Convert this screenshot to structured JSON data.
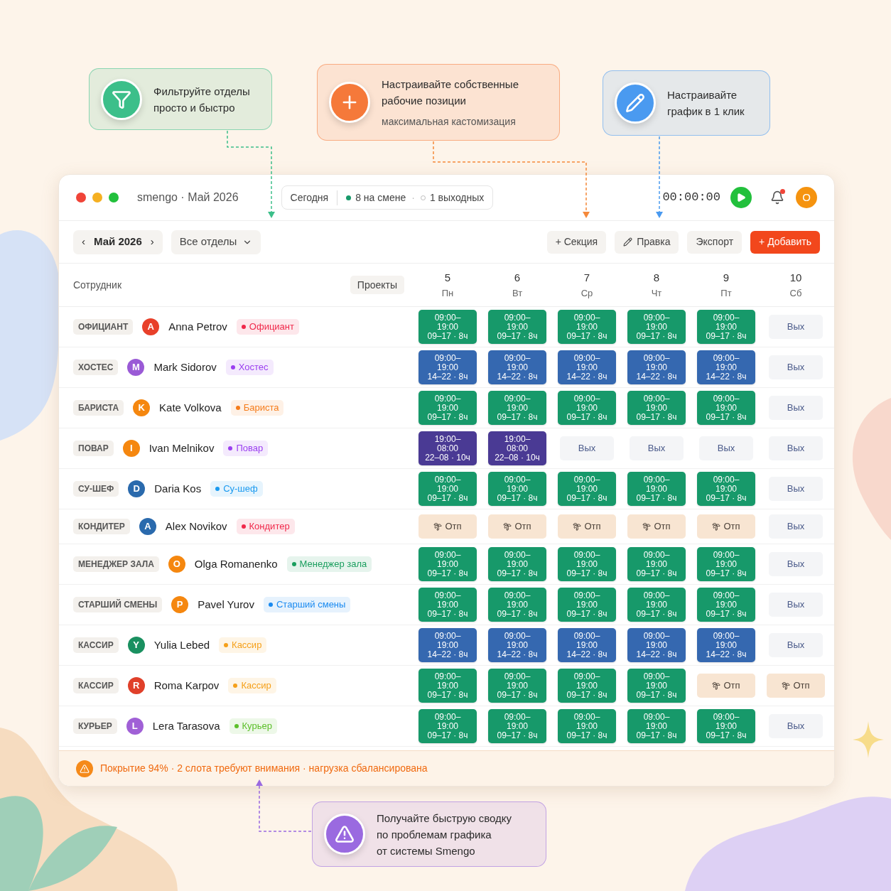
{
  "callouts": [
    {
      "kind": "filter",
      "color": "#3cbf8a",
      "lines": [
        "Фильтруйте отделы",
        "просто и быстро"
      ]
    },
    {
      "kind": "plus",
      "color": "#f5793a",
      "lines": [
        "Настраивайте собственные",
        "рабочие позиции"
      ],
      "subtitle": "максимальная кастомизация"
    },
    {
      "kind": "pencil",
      "color": "#4a9af0",
      "lines": [
        "Настраивайте",
        "график в 1 клик"
      ]
    },
    {
      "kind": "warning",
      "color": "#9a6ae0",
      "lines": [
        "Получайте быструю сводку",
        "по проблемам графика",
        "от системы Smengo"
      ]
    }
  ],
  "window": {
    "title": "smengo · Май 2026",
    "today": "Сегодня",
    "on_shift": "8 на смене",
    "separator": "·",
    "days_off": "1 выходных",
    "timer": "00:00:00",
    "notification": true,
    "avatar": "O"
  },
  "toolbar": {
    "prev": "‹",
    "month": "Май 2026",
    "next": "›",
    "department_filter": "Все отделы",
    "buttons": [
      {
        "kind": "section",
        "label": "+ Секция"
      },
      {
        "kind": "edit",
        "label": "Правка"
      },
      {
        "kind": "export",
        "label": "Экспорт"
      },
      {
        "kind": "add",
        "label": "+ Добавить"
      }
    ]
  },
  "table": {
    "employee_header": "Сотрудник",
    "projects_button": "Проекты",
    "days": [
      {
        "number": "5",
        "weekday": "Пн"
      },
      {
        "number": "6",
        "weekday": "Вт"
      },
      {
        "number": "7",
        "weekday": "Ср"
      },
      {
        "number": "8",
        "weekday": "Чт"
      },
      {
        "number": "9",
        "weekday": "Пт"
      },
      {
        "number": "10",
        "weekday": "Сб"
      }
    ],
    "rows": [
      {
        "department": "ОФИЦИАНТ",
        "avatar": {
          "initial": "A",
          "color": "#e8402a"
        },
        "name": "Anna Petrov",
        "role": {
          "label": "Официант",
          "color": "#f0284a"
        },
        "shifts": [
          {
            "kind": "shift",
            "color": "#17996a",
            "start": "09:00–",
            "end": "19:00",
            "range": "09–17 · 8ч"
          },
          {
            "kind": "shift",
            "color": "#17996a",
            "start": "09:00–",
            "end": "19:00",
            "range": "09–17 · 8ч"
          },
          {
            "kind": "shift",
            "color": "#17996a",
            "start": "09:00–",
            "end": "19:00",
            "range": "09–17 · 8ч"
          },
          {
            "kind": "shift",
            "color": "#17996a",
            "start": "09:00–",
            "end": "19:00",
            "range": "09–17 · 8ч"
          },
          {
            "kind": "shift",
            "color": "#17996a",
            "start": "09:00–",
            "end": "19:00",
            "range": "09–17 · 8ч"
          },
          {
            "kind": "off",
            "label": "Вых"
          }
        ]
      },
      {
        "department": "ХОСТЕС",
        "avatar": {
          "initial": "M",
          "color": "#9a5ad6"
        },
        "name": "Mark Sidorov",
        "role": {
          "label": "Хостес",
          "color": "#9b3ff0"
        },
        "shifts": [
          {
            "kind": "shift",
            "color": "#3568b0",
            "start": "09:00–",
            "end": "19:00",
            "range": "14–22 · 8ч"
          },
          {
            "kind": "shift",
            "color": "#3568b0",
            "start": "09:00–",
            "end": "19:00",
            "range": "14–22 · 8ч"
          },
          {
            "kind": "shift",
            "color": "#3568b0",
            "start": "09:00–",
            "end": "19:00",
            "range": "14–22 · 8ч"
          },
          {
            "kind": "shift",
            "color": "#3568b0",
            "start": "09:00–",
            "end": "19:00",
            "range": "14–22 · 8ч"
          },
          {
            "kind": "shift",
            "color": "#3568b0",
            "start": "09:00–",
            "end": "19:00",
            "range": "14–22 · 8ч"
          },
          {
            "kind": "off",
            "label": "Вых"
          }
        ]
      },
      {
        "department": "БАРИСТА",
        "avatar": {
          "initial": "K",
          "color": "#f5870f"
        },
        "name": "Kate Volkova",
        "role": {
          "label": "Бариста",
          "color": "#f57c1a"
        },
        "shifts": [
          {
            "kind": "shift",
            "color": "#17996a",
            "start": "09:00–",
            "end": "19:00",
            "range": "09–17 · 8ч"
          },
          {
            "kind": "shift",
            "color": "#17996a",
            "start": "09:00–",
            "end": "19:00",
            "range": "09–17 · 8ч"
          },
          {
            "kind": "shift",
            "color": "#17996a",
            "start": "09:00–",
            "end": "19:00",
            "range": "09–17 · 8ч"
          },
          {
            "kind": "shift",
            "color": "#17996a",
            "start": "09:00–",
            "end": "19:00",
            "range": "09–17 · 8ч"
          },
          {
            "kind": "shift",
            "color": "#17996a",
            "start": "09:00–",
            "end": "19:00",
            "range": "09–17 · 8ч"
          },
          {
            "kind": "off",
            "label": "Вых"
          }
        ]
      },
      {
        "department": "ПОВАР",
        "avatar": {
          "initial": "I",
          "color": "#f5870f"
        },
        "name": "Ivan Melnikov",
        "role": {
          "label": "Повар",
          "color": "#9b3ff0"
        },
        "shifts": [
          {
            "kind": "shift",
            "color": "#4a3a94",
            "start": "19:00–",
            "end": "08:00",
            "range": "22–08 · 10ч"
          },
          {
            "kind": "shift",
            "color": "#4a3a94",
            "start": "19:00–",
            "end": "08:00",
            "range": "22–08 · 10ч"
          },
          {
            "kind": "off",
            "label": "Вых"
          },
          {
            "kind": "off",
            "label": "Вых"
          },
          {
            "kind": "off",
            "label": "Вых"
          },
          {
            "kind": "off",
            "label": "Вых"
          }
        ]
      },
      {
        "department": "СУ-ШЕФ",
        "avatar": {
          "initial": "D",
          "color": "#2a6aad"
        },
        "name": "Daria Kos",
        "role": {
          "label": "Су-шеф",
          "color": "#1a9af0"
        },
        "shifts": [
          {
            "kind": "shift",
            "color": "#17996a",
            "start": "09:00–",
            "end": "19:00",
            "range": "09–17 · 8ч"
          },
          {
            "kind": "shift",
            "color": "#17996a",
            "start": "09:00–",
            "end": "19:00",
            "range": "09–17 · 8ч"
          },
          {
            "kind": "shift",
            "color": "#17996a",
            "start": "09:00–",
            "end": "19:00",
            "range": "09–17 · 8ч"
          },
          {
            "kind": "shift",
            "color": "#17996a",
            "start": "09:00–",
            "end": "19:00",
            "range": "09–17 · 8ч"
          },
          {
            "kind": "shift",
            "color": "#17996a",
            "start": "09:00–",
            "end": "19:00",
            "range": "09–17 · 8ч"
          },
          {
            "kind": "off",
            "label": "Вых"
          }
        ]
      },
      {
        "department": "КОНДИТЕР",
        "avatar": {
          "initial": "A",
          "color": "#2a6aad"
        },
        "name": "Alex Novikov",
        "role": {
          "label": "Кондитер",
          "color": "#f0284a"
        },
        "shifts": [
          {
            "kind": "vacation",
            "label": "Отп"
          },
          {
            "kind": "vacation",
            "label": "Отп"
          },
          {
            "kind": "vacation",
            "label": "Отп"
          },
          {
            "kind": "vacation",
            "label": "Отп"
          },
          {
            "kind": "vacation",
            "label": "Отп"
          },
          {
            "kind": "off",
            "label": "Вых"
          }
        ]
      },
      {
        "department": "МЕНЕДЖЕР ЗАЛА",
        "avatar": {
          "initial": "O",
          "color": "#f5870f"
        },
        "name": "Olga Romanenko",
        "role": {
          "label": "Менеджер зала",
          "color": "#1a9e5e"
        },
        "shifts": [
          {
            "kind": "shift",
            "color": "#17996a",
            "start": "09:00–",
            "end": "19:00",
            "range": "09–17 · 8ч"
          },
          {
            "kind": "shift",
            "color": "#17996a",
            "start": "09:00–",
            "end": "19:00",
            "range": "09–17 · 8ч"
          },
          {
            "kind": "shift",
            "color": "#17996a",
            "start": "09:00–",
            "end": "19:00",
            "range": "09–17 · 8ч"
          },
          {
            "kind": "shift",
            "color": "#17996a",
            "start": "09:00–",
            "end": "19:00",
            "range": "09–17 · 8ч"
          },
          {
            "kind": "shift",
            "color": "#17996a",
            "start": "09:00–",
            "end": "19:00",
            "range": "09–17 · 8ч"
          },
          {
            "kind": "off",
            "label": "Вых"
          }
        ]
      },
      {
        "department": "СТАРШИЙ СМЕНЫ",
        "avatar": {
          "initial": "P",
          "color": "#f5870f"
        },
        "name": "Pavel Yurov",
        "role": {
          "label": "Старший смены",
          "color": "#1a8af0"
        },
        "shifts": [
          {
            "kind": "shift",
            "color": "#17996a",
            "start": "09:00–",
            "end": "19:00",
            "range": "09–17 · 8ч"
          },
          {
            "kind": "shift",
            "color": "#17996a",
            "start": "09:00–",
            "end": "19:00",
            "range": "09–17 · 8ч"
          },
          {
            "kind": "shift",
            "color": "#17996a",
            "start": "09:00–",
            "end": "19:00",
            "range": "09–17 · 8ч"
          },
          {
            "kind": "shift",
            "color": "#17996a",
            "start": "09:00–",
            "end": "19:00",
            "range": "09–17 · 8ч"
          },
          {
            "kind": "shift",
            "color": "#17996a",
            "start": "09:00–",
            "end": "19:00",
            "range": "09–17 · 8ч"
          },
          {
            "kind": "off",
            "label": "Вых"
          }
        ]
      },
      {
        "department": "КАССИР",
        "avatar": {
          "initial": "Y",
          "color": "#1a9060"
        },
        "name": "Yulia Lebed",
        "role": {
          "label": "Кассир",
          "color": "#f5a01a"
        },
        "shifts": [
          {
            "kind": "shift",
            "color": "#3568b0",
            "start": "09:00–",
            "end": "19:00",
            "range": "14–22 · 8ч"
          },
          {
            "kind": "shift",
            "color": "#3568b0",
            "start": "09:00–",
            "end": "19:00",
            "range": "14–22 · 8ч"
          },
          {
            "kind": "shift",
            "color": "#3568b0",
            "start": "09:00–",
            "end": "19:00",
            "range": "14–22 · 8ч"
          },
          {
            "kind": "shift",
            "color": "#3568b0",
            "start": "09:00–",
            "end": "19:00",
            "range": "14–22 · 8ч"
          },
          {
            "kind": "shift",
            "color": "#3568b0",
            "start": "09:00–",
            "end": "19:00",
            "range": "14–22 · 8ч"
          },
          {
            "kind": "off",
            "label": "Вых"
          }
        ]
      },
      {
        "department": "КАССИР",
        "avatar": {
          "initial": "R",
          "color": "#e0402a"
        },
        "name": "Roma Karpov",
        "role": {
          "label": "Кассир",
          "color": "#f5a01a"
        },
        "shifts": [
          {
            "kind": "shift",
            "color": "#17996a",
            "start": "09:00–",
            "end": "19:00",
            "range": "09–17 · 8ч"
          },
          {
            "kind": "shift",
            "color": "#17996a",
            "start": "09:00–",
            "end": "19:00",
            "range": "09–17 · 8ч"
          },
          {
            "kind": "shift",
            "color": "#17996a",
            "start": "09:00–",
            "end": "19:00",
            "range": "09–17 · 8ч"
          },
          {
            "kind": "shift",
            "color": "#17996a",
            "start": "09:00–",
            "end": "19:00",
            "range": "09–17 · 8ч"
          },
          {
            "kind": "vacation",
            "label": "Отп"
          },
          {
            "kind": "vacation",
            "label": "Отп"
          }
        ]
      },
      {
        "department": "КУРЬЕР",
        "avatar": {
          "initial": "L",
          "color": "#a060d6"
        },
        "name": "Lera Tarasova",
        "role": {
          "label": "Курьер",
          "color": "#5cbf2a"
        },
        "shifts": [
          {
            "kind": "shift",
            "color": "#17996a",
            "start": "09:00–",
            "end": "19:00",
            "range": "09–17 · 8ч"
          },
          {
            "kind": "shift",
            "color": "#17996a",
            "start": "09:00–",
            "end": "19:00",
            "range": "09–17 · 8ч"
          },
          {
            "kind": "shift",
            "color": "#17996a",
            "start": "09:00–",
            "end": "19:00",
            "range": "09–17 · 8ч"
          },
          {
            "kind": "shift",
            "color": "#17996a",
            "start": "09:00–",
            "end": "19:00",
            "range": "09–17 · 8ч"
          },
          {
            "kind": "shift",
            "color": "#17996a",
            "start": "09:00–",
            "end": "19:00",
            "range": "09–17 · 8ч"
          },
          {
            "kind": "off",
            "label": "Вых"
          }
        ]
      }
    ]
  },
  "status_bar": {
    "text": "Покрытие 94% · 2 слота требуют внимания · нагрузка сбалансирована"
  }
}
